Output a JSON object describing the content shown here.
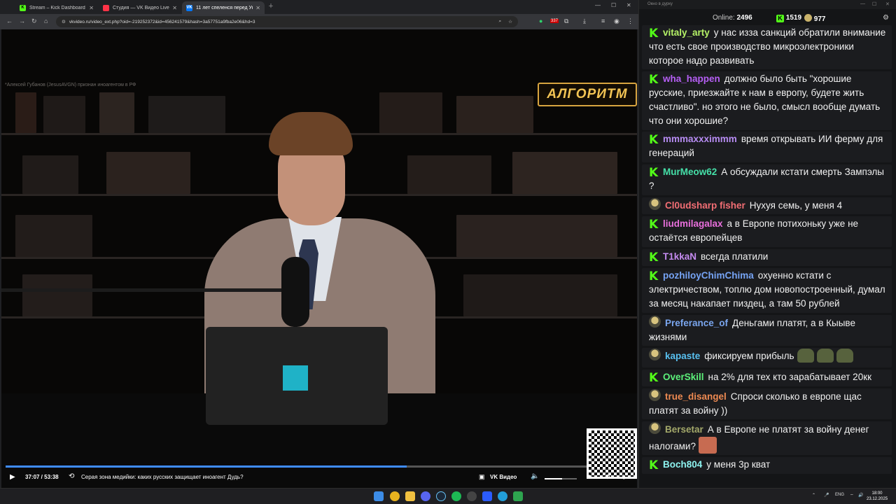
{
  "browser": {
    "tabs": [
      {
        "title": "Stream – Kick Dashboard",
        "favicon": "kick-icon",
        "color": "#53fc18",
        "active": false
      },
      {
        "title": "Студия — VK Видео Live",
        "favicon": "vk-live-icon",
        "color": "#ff3347",
        "active": false
      },
      {
        "title": "11 лет спеленся перед Укр",
        "favicon": "vk-icon",
        "color": "#0077ff",
        "active": true
      }
    ],
    "url": "vkvideo.ru/video_ext.php?oid=-219252372&id=456241579&hash=3a57751a9fba2e06&hd=3",
    "extension_badge": "337"
  },
  "video": {
    "notice": "*Алексей Губанов (JesusAVGN) признан иноагентом в РФ",
    "logo": "АЛГОРИТМ",
    "current_time": "37:07",
    "duration": "53:38",
    "time_display": "37:07 / 53:38",
    "title": "Серая зона медийки: каких русских защищает иноагент Дудь?",
    "brand": "VK Видео",
    "progress": 0.69,
    "volume": 0.55,
    "accent_color": "#3f8cff"
  },
  "chat": {
    "window_title": "Окно в дурку",
    "online_label": "Online:",
    "online_count": "2496",
    "kick_count": "1519",
    "vk_count": "977",
    "messages": [
      {
        "user": "vitaly_arty",
        "color": "#b5f267",
        "badge": "kick",
        "text": "у нас изза санкций обратили внимание что есть свое производство микроэлектроники которое надо развивать"
      },
      {
        "user": "wha_happen",
        "color": "#b65ff5",
        "badge": "kick",
        "text": "должно было быть \"хорошие русские, приезжайте к нам в европу, будете жить счастливо\". но этого не было, смысл вообще думать что они хорошие?"
      },
      {
        "user": "mmmaxxximmm",
        "color": "#b78cf3",
        "badge": "kick",
        "text": "время открывать ИИ ферму для генераций"
      },
      {
        "user": "MurMeow62",
        "color": "#45e0a8",
        "badge": "kick",
        "text": "А обсуждали кстати смерть Зампэлы ?"
      },
      {
        "user": "Cl0udsharp fisher",
        "color": "#f26e74",
        "badge": "avatar",
        "text": "Нухуя семь, у меня 4"
      },
      {
        "user": "liudmilagalax",
        "color": "#e86fdc",
        "badge": "kick",
        "text": "а в Европе потихоньку уже не остаётся европейцев"
      },
      {
        "user": "T1kkaN",
        "color": "#c58bf0",
        "badge": "kick",
        "text": "всегда платили"
      },
      {
        "user": "pozhiloyChimChima",
        "color": "#76a4f5",
        "badge": "kick",
        "text": "охуенно кстати с электричеством, топлю дом новопостроенный, думал за месяц накапает пиздец, а там 50 рублей"
      },
      {
        "user": "Preferance_of",
        "color": "#7aa6ef",
        "badge": "avatar",
        "text": "Деньгами платят, а в Кыыве жизнями"
      },
      {
        "user": "kapaste",
        "color": "#58c0f0",
        "badge": "avatar",
        "text": "фиксируем прибыль",
        "emotes": [
          "pepe-emote",
          "pepe-emote",
          "pepe-emote"
        ]
      },
      {
        "user": "OverSkill",
        "color": "#5cf07a",
        "badge": "kick",
        "text": "на 2% для тех кто зарабатывает 20кк"
      },
      {
        "user": "true_disangel",
        "color": "#ee8a52",
        "badge": "avatar",
        "text": "Спроси сколько в европе щас платят за войну ))"
      },
      {
        "user": "Bersetar",
        "color": "#a3a86a",
        "badge": "avatar",
        "text": "А в Европе не платят за войну денег налогами?",
        "emotes": [
          "face-emote"
        ]
      },
      {
        "user": "Boch804",
        "color": "#8ef3f0",
        "badge": "kick",
        "text": "у меня 3р кват"
      }
    ]
  },
  "taskbar": {
    "lang": "ENG",
    "time": "18:00",
    "date": "23.12.2025"
  }
}
